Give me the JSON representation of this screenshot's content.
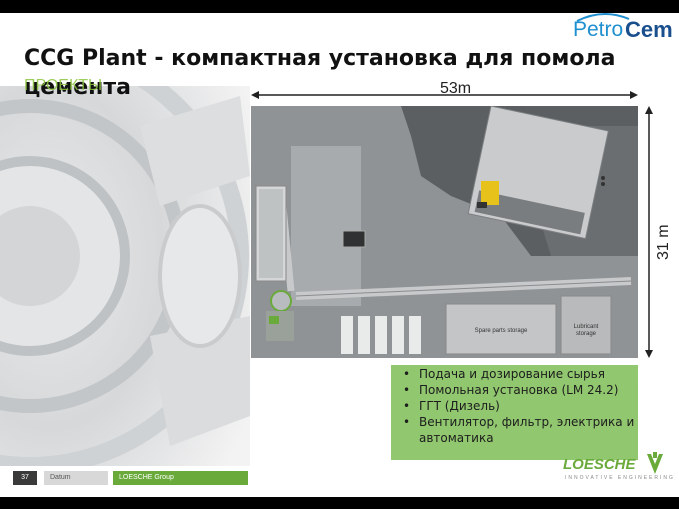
{
  "slide": {
    "title": "ССG Plant - компактная установка для помола цемента",
    "subtitle": "ПРОЕКТЫ"
  },
  "logo": {
    "part1": "Petro",
    "part2": "Cem"
  },
  "dimensions": {
    "width_label": "53m",
    "height_label": "31 m"
  },
  "plan": {
    "spare_parts": "Spare parts storage",
    "lubricant_storage": "Lubricant storage"
  },
  "features": [
    "Подача и дозирование сырья",
    "Помольная установка (LM 24.2)",
    "ГГТ (Дизель)",
    "Вентилятор, фильтр, электрика и автоматика"
  ],
  "footer": {
    "page_number": "37",
    "datum": "Datum",
    "group": "LOESCHE Group"
  },
  "loesche": {
    "name": "LOESCHE",
    "tagline": "INNOVATIVE ENGINEERING"
  },
  "colors": {
    "accent_green": "#8cc568",
    "petrocem_blue": "#1a4f8e"
  }
}
